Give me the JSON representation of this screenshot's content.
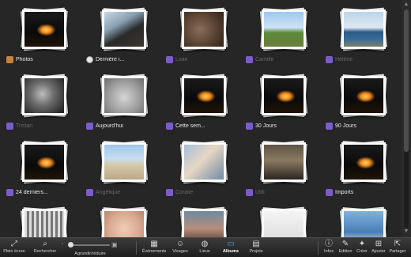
{
  "albums": [
    {
      "label": "Photos",
      "icon": "photos-icon",
      "bright": true,
      "thumb": "fire"
    },
    {
      "label": "Dernière i...",
      "icon": "clock-icon",
      "bright": true,
      "thumb": "cave"
    },
    {
      "label": "Loan",
      "icon": "album-icon",
      "bright": false,
      "thumb": "hedge"
    },
    {
      "label": "Camille",
      "icon": "album-icon",
      "bright": false,
      "thumb": "dome"
    },
    {
      "label": "Hélène",
      "icon": "album-icon",
      "bright": false,
      "thumb": "sea"
    },
    {
      "label": "Tristan",
      "icon": "album-icon",
      "bright": false,
      "thumb": "bird"
    },
    {
      "label": "Aujourd'hui",
      "icon": "album-icon",
      "bright": true,
      "thumb": "gray"
    },
    {
      "label": "Cette sem...",
      "icon": "album-icon",
      "bright": true,
      "thumb": "fire"
    },
    {
      "label": "30 Jours",
      "icon": "album-icon",
      "bright": true,
      "thumb": "fire"
    },
    {
      "label": "90 Jours",
      "icon": "album-icon",
      "bright": true,
      "thumb": "fire"
    },
    {
      "label": "24 derniers...",
      "icon": "album-icon",
      "bright": true,
      "thumb": "fire"
    },
    {
      "label": "Angélique",
      "icon": "album-icon",
      "bright": false,
      "thumb": "beach"
    },
    {
      "label": "Coralie",
      "icon": "album-icon",
      "bright": false,
      "thumb": "baby"
    },
    {
      "label": "Utili",
      "icon": "album-icon",
      "bright": false,
      "thumb": "rocks"
    },
    {
      "label": "Imports",
      "icon": "album-icon",
      "bright": true,
      "thumb": "fire"
    },
    {
      "label": "",
      "icon": "album-icon",
      "bright": false,
      "thumb": "crib"
    },
    {
      "label": "",
      "icon": "album-icon",
      "bright": false,
      "thumb": "hands"
    },
    {
      "label": "",
      "icon": "album-icon",
      "bright": false,
      "thumb": "party"
    },
    {
      "label": "",
      "icon": "album-icon",
      "bright": false,
      "thumb": "white"
    },
    {
      "label": "",
      "icon": "album-icon",
      "bright": false,
      "thumb": "blue"
    }
  ],
  "toolbar": {
    "fullscreen": "Plein écran",
    "search": "Rechercher",
    "zoom": "Agrandir/réduire",
    "events": "Événements",
    "faces": "Visages",
    "places": "Lieux",
    "albums": "Albums",
    "projects": "Projets",
    "info": "Infos",
    "edit": "Edition",
    "create": "Créer",
    "add": "Ajouter",
    "share": "Partager"
  },
  "zoom_level": 0.0,
  "colors": {
    "accent": "#4aa3ff",
    "album_icon": "#7b5cc9",
    "background": "#262626"
  }
}
